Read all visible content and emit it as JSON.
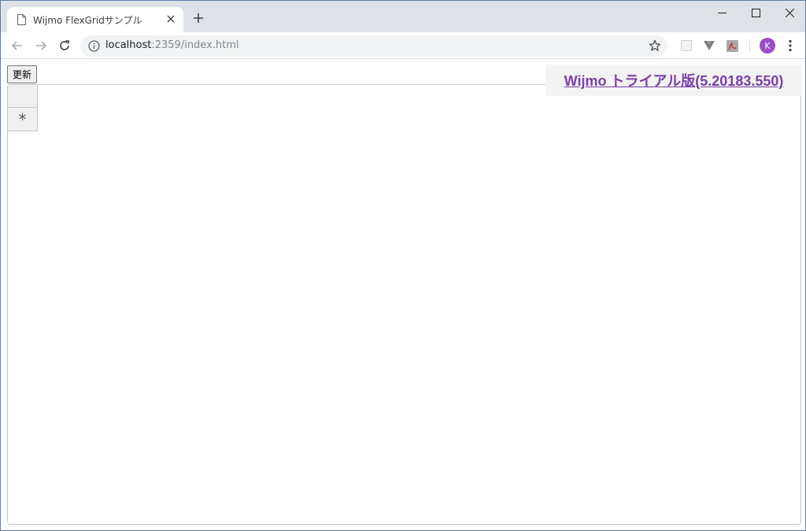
{
  "browser": {
    "tab": {
      "title": "Wijmo FlexGridサンプル"
    },
    "address": {
      "host": "localhost",
      "path": ":2359/index.html"
    },
    "avatar_initial": "K"
  },
  "page": {
    "refresh_button_label": "更新",
    "trial_banner_text": "Wijmo トライアル版(5.20183.550)",
    "grid": {
      "new_row_marker": "*"
    }
  },
  "colors": {
    "trial_link": "#7b3fa5",
    "avatar": "#9c4dcc",
    "tabstrip": "#dee1e6"
  },
  "icons": {
    "tab": "page-icon",
    "close": "close-icon",
    "new_tab": "plus-icon",
    "back": "arrow-left-icon",
    "forward": "arrow-right-icon",
    "reload": "reload-icon",
    "info": "info-icon",
    "bookmark": "star-icon",
    "menu": "kebab-menu-icon"
  }
}
